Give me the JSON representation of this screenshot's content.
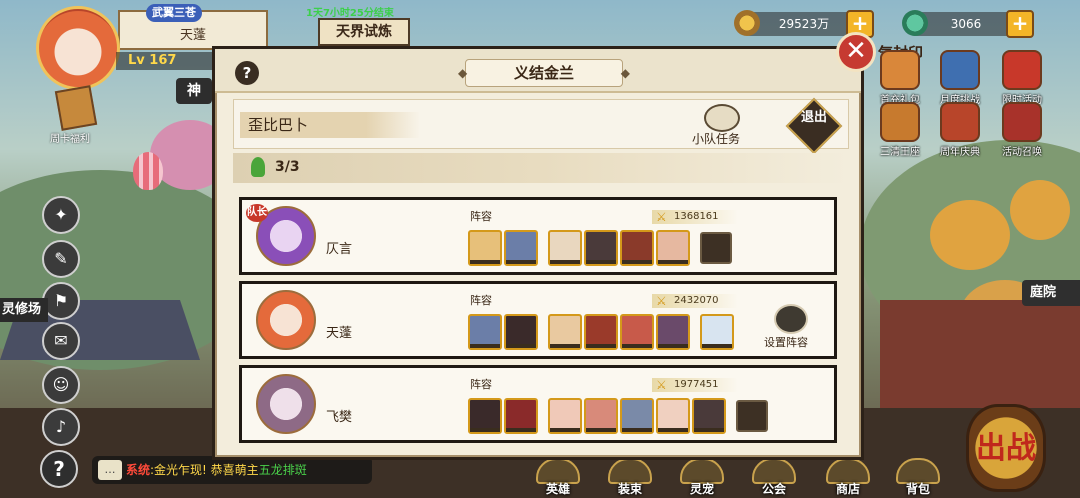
{
  "hud": {
    "badge": "武翼三苍",
    "player_name": "天蓬",
    "level": "Lv 167",
    "event_timer": "1天7小时25分结束",
    "trial_label": "天界试炼",
    "side_tag": "神",
    "weekcard_label": "周卡福利",
    "coins": "29523万",
    "jade": "3066",
    "plus": "+"
  },
  "events": {
    "title": "气封印",
    "items": [
      "首充礼包",
      "月度挑战",
      "限时活动",
      "三清王座",
      "周年庆典",
      "活动召唤"
    ],
    "court": "庭院"
  },
  "left": {
    "cultivation_tag": "灵修场"
  },
  "system_bar": {
    "tag": "系统",
    "message": ":金光乍现! 恭喜萌主",
    "highlight": "五龙排斑"
  },
  "bottom_nav": [
    "英雄",
    "装束",
    "灵宠",
    "公会",
    "商店",
    "背包"
  ],
  "battle_label": "出战",
  "modal": {
    "title": "义结金兰",
    "help": "?",
    "close": "✕",
    "team_name": "歪比巴卜",
    "task_label": "小队任务",
    "quit_label": "退出",
    "member_count": "3/3",
    "members": [
      {
        "name": "仄言",
        "leader_tag": "队长",
        "lineup_label": "阵容",
        "power": "1368161",
        "heroes": 7,
        "empty_slot": true,
        "set_lineup": false
      },
      {
        "name": "天蓬",
        "leader_tag": "",
        "lineup_label": "阵容",
        "power": "2432070",
        "heroes": 8,
        "empty_slot": false,
        "set_lineup": true,
        "set_lineup_label": "设置阵容"
      },
      {
        "name": "飞樊",
        "leader_tag": "",
        "lineup_label": "阵容",
        "power": "1977451",
        "heroes": 7,
        "empty_slot": true,
        "set_lineup": false
      }
    ]
  },
  "colors": {
    "modal_bg": "#f3eddc",
    "close_red": "#c63a31",
    "hero_border": "#d4991a"
  }
}
